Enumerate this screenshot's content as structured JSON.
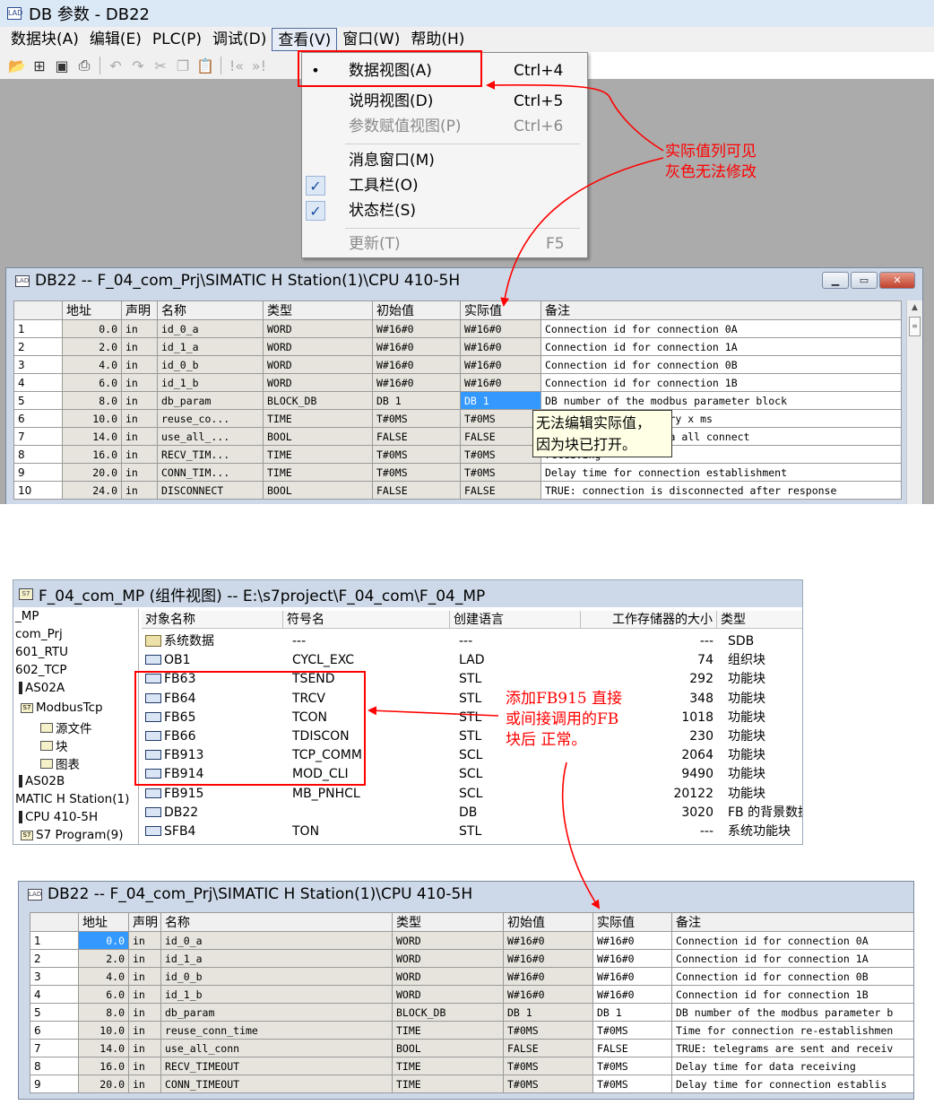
{
  "app": {
    "title": "DB 参数 - DB22",
    "menus": [
      "数据块(A)",
      "编辑(E)",
      "PLC(P)",
      "调试(D)",
      "查看(V)",
      "窗口(W)",
      "帮助(H)"
    ],
    "open_menu_index": 4,
    "toolbar_icons": [
      "open-icon",
      "network-icon",
      "save-icon",
      "print-icon",
      "undo-icon",
      "redo-icon",
      "cut-icon",
      "copy-icon",
      "paste-icon",
      "first-icon",
      "prev-icon"
    ]
  },
  "view_menu": {
    "items": [
      {
        "label": "数据视图(A)",
        "shortcut": "Ctrl+4",
        "mark": "•",
        "disabled": false
      },
      {
        "label": "说明视图(D)",
        "shortcut": "Ctrl+5",
        "mark": "",
        "disabled": false
      },
      {
        "label": "参数赋值视图(P)",
        "shortcut": "Ctrl+6",
        "mark": "",
        "disabled": true
      },
      {
        "label": "消息窗口(M)",
        "shortcut": "",
        "mark": "",
        "disabled": false
      },
      {
        "label": "工具栏(O)",
        "shortcut": "",
        "mark": "✓",
        "disabled": false
      },
      {
        "label": "状态栏(S)",
        "shortcut": "",
        "mark": "✓",
        "disabled": false
      },
      {
        "label": "更新(T)",
        "shortcut": "F5",
        "mark": "",
        "disabled": true
      }
    ]
  },
  "annotations": {
    "note1_line1": "实际值列可见",
    "note1_line2": "灰色无法修改",
    "tooltip_line1": "无法编辑实际值，",
    "tooltip_line2": "因为块已打开。",
    "note2_line1": "添加FB915 直接",
    "note2_line2": "或间接调用的FB",
    "note2_line3": "块后 正常。"
  },
  "db_window_1": {
    "title": "DB22 -- F_04_com_Prj\\SIMATIC H Station(1)\\CPU 410-5H",
    "columns": [
      "",
      "地址",
      "声明",
      "名称",
      "类型",
      "初始值",
      "实际值",
      "备注"
    ],
    "rows": [
      [
        "1",
        "0.0",
        "in",
        "id_0_a",
        "WORD",
        "W#16#0",
        "W#16#0",
        "Connection id for connection 0A"
      ],
      [
        "2",
        "2.0",
        "in",
        "id_1_a",
        "WORD",
        "W#16#0",
        "W#16#0",
        "Connection id for connection 1A"
      ],
      [
        "3",
        "4.0",
        "in",
        "id_0_b",
        "WORD",
        "W#16#0",
        "W#16#0",
        "Connection id for connection 0B"
      ],
      [
        "4",
        "6.0",
        "in",
        "id_1_b",
        "WORD",
        "W#16#0",
        "W#16#0",
        "Connection id for connection 1B"
      ],
      [
        "5",
        "8.0",
        "in",
        "db_param",
        "BLOCK_DB",
        "DB 1",
        "DB 1",
        "DB number of the modbus parameter block"
      ],
      [
        "6",
        "10.0",
        "in",
        "reuse_co...",
        "TIME",
        "T#0MS",
        "T#0MS",
        "re-establishment every x ms"
      ],
      [
        "7",
        "14.0",
        "in",
        "use_all_...",
        "BOOL",
        "FALSE",
        "FALSE",
        "sent and received via all connect"
      ],
      [
        "8",
        "16.0",
        "in",
        "RECV_TIM...",
        "TIME",
        "T#0MS",
        "T#0MS",
        "receiving"
      ],
      [
        "9",
        "20.0",
        "in",
        "CONN_TIM...",
        "TIME",
        "T#0MS",
        "T#0MS",
        "Delay time for connection establishment"
      ],
      [
        "10",
        "24.0",
        "in",
        "DISCONNECT",
        "BOOL",
        "FALSE",
        "FALSE",
        "TRUE: connection is disconnected after response"
      ]
    ]
  },
  "component_view": {
    "title": "F_04_com_MP (组件视图) -- E:\\s7project\\F_04_com\\F_04_MP",
    "tree": [
      "_MP",
      "com_Prj",
      "601_RTU",
      "602_TCP",
      "AS02A",
      "ModbusTcp",
      "源文件",
      "块",
      "图表",
      "AS02B",
      "MATIC H Station(1)",
      "CPU 410-5H",
      "S7 Program(9)"
    ],
    "columns": [
      "对象名称",
      "符号名",
      "创建语言",
      "工作存储器的大小",
      "类型"
    ],
    "rows": [
      [
        "系统数据",
        "---",
        "---",
        "---",
        "SDB"
      ],
      [
        "OB1",
        "CYCL_EXC",
        "LAD",
        "74",
        "组织块"
      ],
      [
        "FB63",
        "TSEND",
        "STL",
        "292",
        "功能块"
      ],
      [
        "FB64",
        "TRCV",
        "STL",
        "348",
        "功能块"
      ],
      [
        "FB65",
        "TCON",
        "STL",
        "1018",
        "功能块"
      ],
      [
        "FB66",
        "TDISCON",
        "STL",
        "230",
        "功能块"
      ],
      [
        "FB913",
        "TCP_COMM",
        "SCL",
        "2064",
        "功能块"
      ],
      [
        "FB914",
        "MOD_CLI",
        "SCL",
        "9490",
        "功能块"
      ],
      [
        "FB915",
        "MB_PNHCL",
        "SCL",
        "20122",
        "功能块"
      ],
      [
        "DB22",
        "",
        "DB",
        "3020",
        "FB 的背景数据"
      ],
      [
        "SFB4",
        "TON",
        "STL",
        "---",
        "系统功能块"
      ]
    ]
  },
  "db_window_2": {
    "title": "DB22 -- F_04_com_Prj\\SIMATIC H Station(1)\\CPU 410-5H",
    "columns": [
      "",
      "地址",
      "声明",
      "名称",
      "类型",
      "初始值",
      "实际值",
      "备注"
    ],
    "rows": [
      [
        "1",
        "0.0",
        "in",
        "id_0_a",
        "WORD",
        "W#16#0",
        "W#16#0",
        "Connection id for connection 0A"
      ],
      [
        "2",
        "2.0",
        "in",
        "id_1_a",
        "WORD",
        "W#16#0",
        "W#16#0",
        "Connection id for connection 1A"
      ],
      [
        "3",
        "4.0",
        "in",
        "id_0_b",
        "WORD",
        "W#16#0",
        "W#16#0",
        "Connection id for connection 0B"
      ],
      [
        "4",
        "6.0",
        "in",
        "id_1_b",
        "WORD",
        "W#16#0",
        "W#16#0",
        "Connection id for connection 1B"
      ],
      [
        "5",
        "8.0",
        "in",
        "db_param",
        "BLOCK_DB",
        "DB 1",
        "DB 1",
        "DB number of the modbus parameter b"
      ],
      [
        "6",
        "10.0",
        "in",
        "reuse_conn_time",
        "TIME",
        "T#0MS",
        "T#0MS",
        "Time for connection re-establishmen"
      ],
      [
        "7",
        "14.0",
        "in",
        "use_all_conn",
        "BOOL",
        "FALSE",
        "FALSE",
        "TRUE: telegrams are sent and receiv"
      ],
      [
        "8",
        "16.0",
        "in",
        "RECV_TIMEOUT",
        "TIME",
        "T#0MS",
        "T#0MS",
        "Delay time for data receiving"
      ],
      [
        "9",
        "20.0",
        "in",
        "CONN_TIMEOUT",
        "TIME",
        "T#0MS",
        "T#0MS",
        "Delay time for connection establis"
      ]
    ]
  },
  "colors": {
    "annotation": "#ff0000",
    "selection": "#3399ff"
  }
}
